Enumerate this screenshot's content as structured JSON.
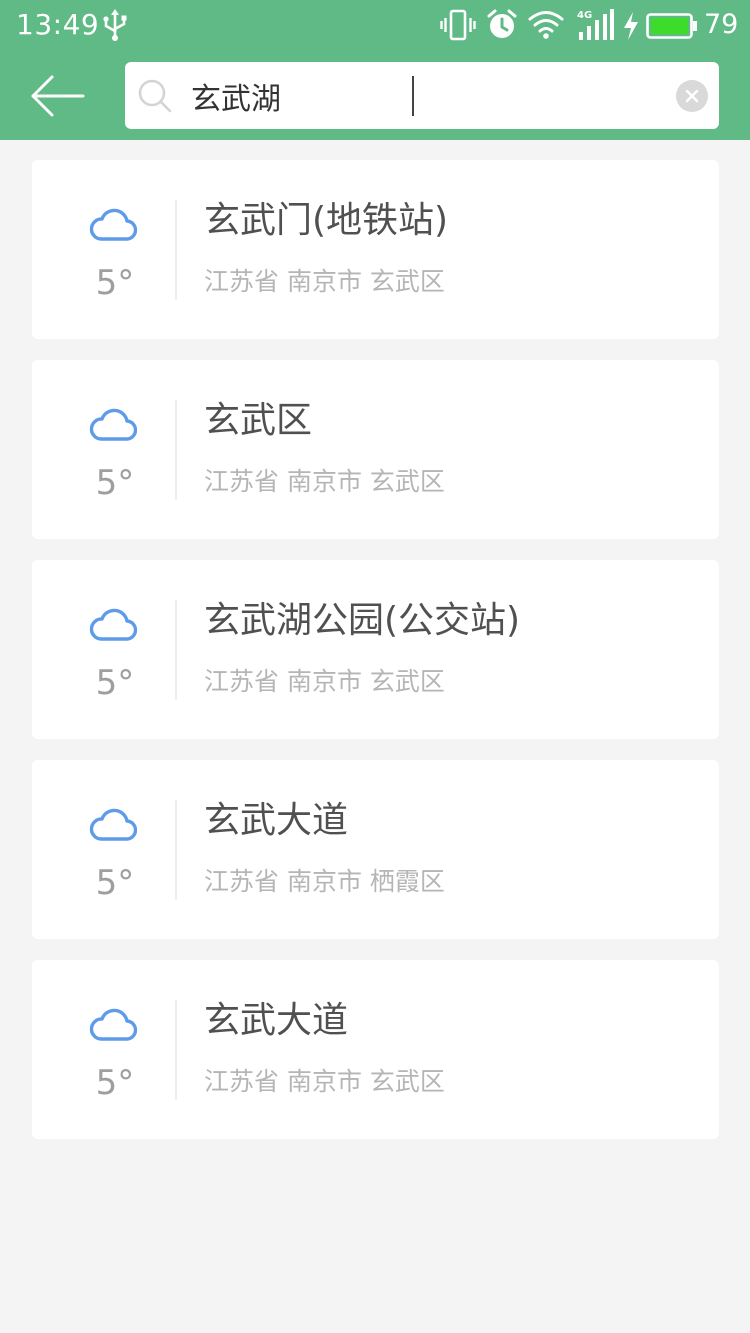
{
  "status": {
    "time": "13:49",
    "battery": "79",
    "network": "4G"
  },
  "colors": {
    "header": "#5fba86",
    "cloud": "#5e9be8",
    "battery_fill": "#3ddc2c"
  },
  "search": {
    "value": "玄武湖"
  },
  "results": [
    {
      "name": "玄武门(地铁站)",
      "region": "江苏省 南京市 玄武区",
      "temp": "5°",
      "weather_icon": "cloud-icon"
    },
    {
      "name": "玄武区",
      "region": "江苏省 南京市 玄武区",
      "temp": "5°",
      "weather_icon": "cloud-icon"
    },
    {
      "name": "玄武湖公园(公交站)",
      "region": "江苏省 南京市 玄武区",
      "temp": "5°",
      "weather_icon": "cloud-icon"
    },
    {
      "name": "玄武大道",
      "region": "江苏省 南京市 栖霞区",
      "temp": "5°",
      "weather_icon": "cloud-icon"
    },
    {
      "name": "玄武大道",
      "region": "江苏省 南京市 玄武区",
      "temp": "5°",
      "weather_icon": "cloud-icon"
    }
  ]
}
